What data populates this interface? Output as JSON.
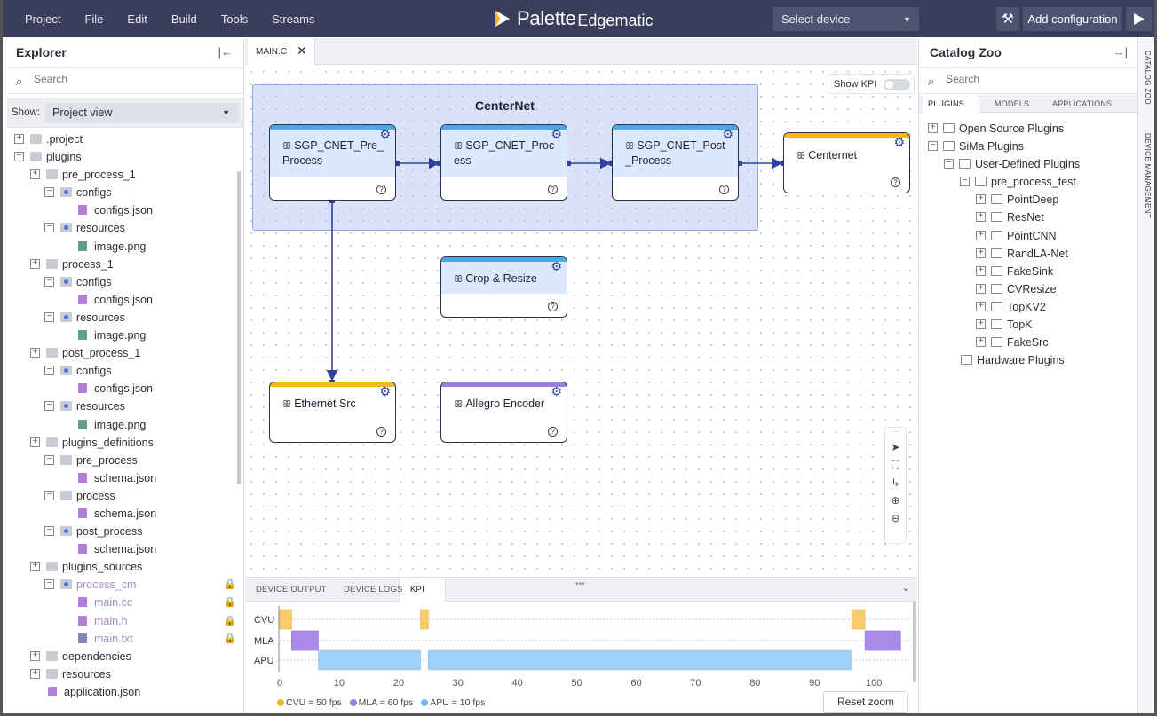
{
  "menu": [
    "Project",
    "File",
    "Edit",
    "Build",
    "Tools",
    "Streams"
  ],
  "brand": {
    "name": "Palette",
    "suffix": "Edgematic"
  },
  "toolbar": {
    "device_select": "Select device",
    "add_configuration": "Add configuration"
  },
  "explorer": {
    "title": "Explorer",
    "search_placeholder": "Search",
    "show_label": "Show:",
    "show_value": "Project view",
    "tree": [
      {
        "label": ".project",
        "level": 0,
        "exp": "+",
        "icon": "folder"
      },
      {
        "label": "plugins",
        "level": 0,
        "exp": "-",
        "icon": "folder"
      },
      {
        "label": "pre_process_1",
        "level": 1,
        "exp": "+",
        "icon": "folder"
      },
      {
        "label": "configs",
        "level": 2,
        "exp": "-",
        "icon": "folder-b"
      },
      {
        "label": "configs.json",
        "level": 3,
        "icon": "json"
      },
      {
        "label": "resources",
        "level": 2,
        "exp": "-",
        "icon": "folder-b"
      },
      {
        "label": "image.png",
        "level": 3,
        "icon": "img"
      },
      {
        "label": "process_1",
        "level": 1,
        "exp": "+",
        "icon": "folder"
      },
      {
        "label": "configs",
        "level": 2,
        "exp": "-",
        "icon": "folder-b"
      },
      {
        "label": "configs.json",
        "level": 3,
        "icon": "json"
      },
      {
        "label": "resources",
        "level": 2,
        "exp": "-",
        "icon": "folder-b"
      },
      {
        "label": "image.png",
        "level": 3,
        "icon": "img"
      },
      {
        "label": "post_process_1",
        "level": 1,
        "exp": "+",
        "icon": "folder"
      },
      {
        "label": "configs",
        "level": 2,
        "exp": "-",
        "icon": "folder-b"
      },
      {
        "label": "configs.json",
        "level": 3,
        "icon": "json"
      },
      {
        "label": "resources",
        "level": 2,
        "exp": "-",
        "icon": "folder-b"
      },
      {
        "label": "image.png",
        "level": 3,
        "icon": "img"
      },
      {
        "label": "plugins_definitions",
        "level": 1,
        "exp": "+",
        "icon": "folder"
      },
      {
        "label": "pre_process",
        "level": 2,
        "exp": "-",
        "icon": "folder"
      },
      {
        "label": "schema.json",
        "level": 3,
        "icon": "json"
      },
      {
        "label": "process",
        "level": 2,
        "exp": "-",
        "icon": "folder"
      },
      {
        "label": "schema.json",
        "level": 3,
        "icon": "json"
      },
      {
        "label": "post_process",
        "level": 2,
        "exp": "-",
        "icon": "folder-b"
      },
      {
        "label": "schema.json",
        "level": 3,
        "icon": "json"
      },
      {
        "label": "plugins_sources",
        "level": 1,
        "exp": "+",
        "icon": "folder"
      },
      {
        "label": "process_cm",
        "level": 2,
        "exp": "-",
        "icon": "folder-b",
        "dim": true,
        "lock": true
      },
      {
        "label": "main.cc",
        "level": 3,
        "icon": "json",
        "dim": true,
        "lock": true
      },
      {
        "label": "main.h",
        "level": 3,
        "icon": "json",
        "dim": true,
        "lock": true
      },
      {
        "label": "main.txt",
        "level": 3,
        "icon": "txt",
        "dim": true,
        "lock": true
      },
      {
        "label": "dependencies",
        "level": 1,
        "exp": "+",
        "icon": "folder"
      },
      {
        "label": "resources",
        "level": 1,
        "exp": "+",
        "icon": "folder"
      },
      {
        "label": "application.json",
        "level": 1,
        "icon": "json"
      }
    ]
  },
  "editor": {
    "tab": "MAIN.C",
    "group_title": "CenterNet",
    "show_kpi_label": "Show KPI",
    "show_kpi_on": false,
    "nodes": [
      {
        "id": "pre",
        "label": "SGP_CNET_Pre_ Process",
        "accent": "blue"
      },
      {
        "id": "proc",
        "label": "SGP_CNET_Proc ess",
        "accent": "blue"
      },
      {
        "id": "post",
        "label": "SGP_CNET_Post _Process",
        "accent": "blue"
      },
      {
        "id": "centernet",
        "label": "Centernet",
        "accent": "yellow"
      },
      {
        "id": "crop",
        "label": "Crop & Resize",
        "accent": "blue"
      },
      {
        "id": "eth",
        "label": "Ethernet Src",
        "accent": "yellow"
      },
      {
        "id": "allegro",
        "label": "Allegro Encoder",
        "accent": "purple"
      }
    ],
    "accent_colors": {
      "blue": "#4aa8e6",
      "yellow": "#f2b820",
      "purple": "#9d7be0"
    }
  },
  "bottom_panel": {
    "tabs": [
      "DEVICE OUTPUT",
      "DEVICE LOGS",
      "KPI"
    ],
    "active_tab": "KPI",
    "reset_zoom": "Reset zoom",
    "legend": [
      {
        "label": "CVU = 50 fps",
        "color": "#f2b820"
      },
      {
        "label": "MLA = 60 fps",
        "color": "#9d7be0"
      },
      {
        "label": "APU = 10 fps",
        "color": "#6db8f2"
      }
    ]
  },
  "chart_data": {
    "type": "timeline",
    "rows": [
      "CVU",
      "MLA",
      "APU"
    ],
    "x_ticks": [
      0,
      10,
      20,
      30,
      40,
      50,
      60,
      70,
      80,
      90,
      100
    ],
    "xlim": [
      0,
      107
    ],
    "segments": {
      "CVU": [
        [
          0,
          2
        ],
        [
          23.7,
          25
        ],
        [
          96.3,
          98.5
        ]
      ],
      "MLA": [
        [
          2,
          6.5
        ],
        [
          98.5,
          104.5
        ]
      ],
      "APU": [
        [
          6.5,
          23.7
        ],
        [
          25,
          96.3
        ]
      ]
    },
    "colors": {
      "CVU": "#f7cd6b",
      "MLA": "#a989ea",
      "APU": "#9fd0f7"
    }
  },
  "catalog": {
    "title": "Catalog Zoo",
    "search_placeholder": "Search",
    "tabs": [
      "PLUGINS",
      "MODELS",
      "APPLICATIONS"
    ],
    "active_tab": "PLUGINS",
    "tree": [
      {
        "label": "Open Source Plugins",
        "level": 0,
        "exp": "+"
      },
      {
        "label": "SiMa Plugins",
        "level": 0,
        "exp": "-"
      },
      {
        "label": "User-Defined Plugins",
        "level": 1,
        "exp": "-"
      },
      {
        "label": "pre_process_test",
        "level": 2,
        "exp": "-"
      },
      {
        "label": "PointDeep",
        "level": 3,
        "exp": "+"
      },
      {
        "label": "ResNet",
        "level": 3,
        "exp": "+"
      },
      {
        "label": "PointCNN",
        "level": 3,
        "exp": "+"
      },
      {
        "label": "RandLA-Net",
        "level": 3,
        "exp": "+"
      },
      {
        "label": "FakeSink",
        "level": 3,
        "exp": "+"
      },
      {
        "label": "CVResize",
        "level": 3,
        "exp": "+"
      },
      {
        "label": "TopKV2",
        "level": 3,
        "exp": "+"
      },
      {
        "label": "TopK",
        "level": 3,
        "exp": "+"
      },
      {
        "label": "FakeSrc",
        "level": 3,
        "exp": "+"
      },
      {
        "label": "Hardware Plugins",
        "level": 1
      }
    ]
  },
  "side_tabs": [
    "CATALOG ZOO",
    "DEVICE MANAGEMENT"
  ]
}
